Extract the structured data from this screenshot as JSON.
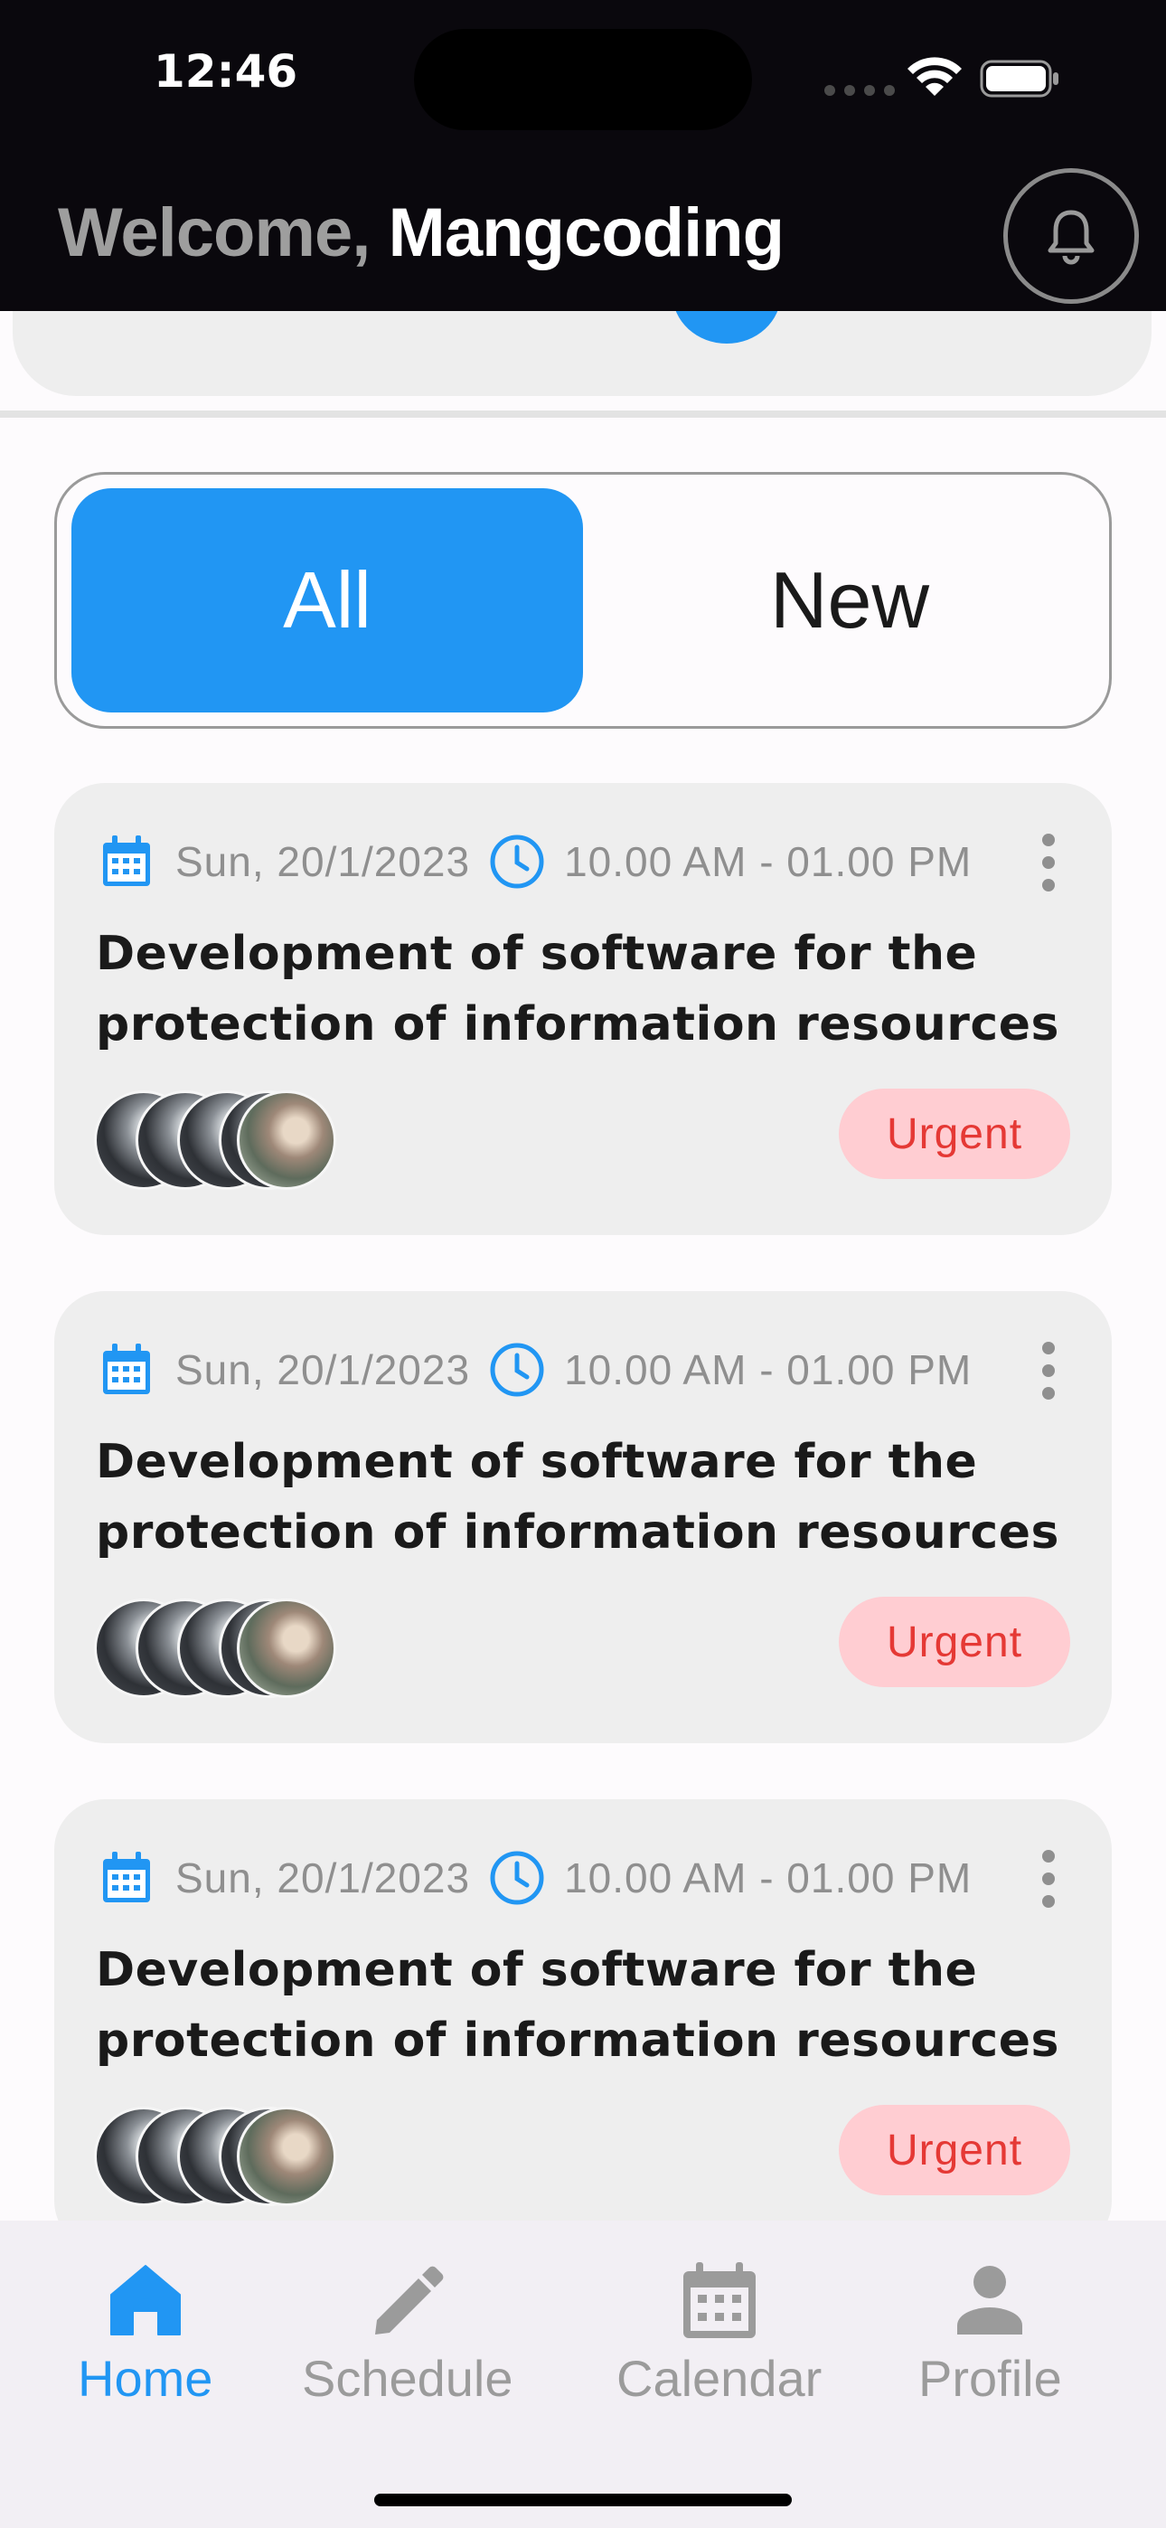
{
  "status_bar": {
    "time": "12:46"
  },
  "header": {
    "welcome_prefix": "Welcome,",
    "user_name": "Mangcoding"
  },
  "tabs": {
    "all_label": "All",
    "new_label": "New",
    "selected": "All"
  },
  "cards": [
    {
      "date": "Sun, 20/1/2023",
      "time": "10.00 AM - 01.00 PM",
      "title": "Development of software for the protection of information resources",
      "badge": "Urgent"
    },
    {
      "date": "Sun, 20/1/2023",
      "time": "10.00 AM - 01.00 PM",
      "title": "Development of software for the protection of information resources",
      "badge": "Urgent"
    },
    {
      "date": "Sun, 20/1/2023",
      "time": "10.00 AM - 01.00 PM",
      "title": "Development of software for the protection of information resources",
      "badge": "Urgent"
    }
  ],
  "bottom_nav": {
    "items": [
      {
        "label": "Home",
        "icon": "home-icon",
        "active": true
      },
      {
        "label": "Schedule",
        "icon": "pencil-icon",
        "active": false
      },
      {
        "label": "Calendar",
        "icon": "calendar-icon",
        "active": false
      },
      {
        "label": "Profile",
        "icon": "person-icon",
        "active": false
      }
    ]
  },
  "colors": {
    "accent": "#2196f3",
    "header_bg": "#0a080d",
    "badge_bg": "#ffcdd2",
    "badge_text": "#e53935",
    "card_bg": "#eeeeee"
  }
}
